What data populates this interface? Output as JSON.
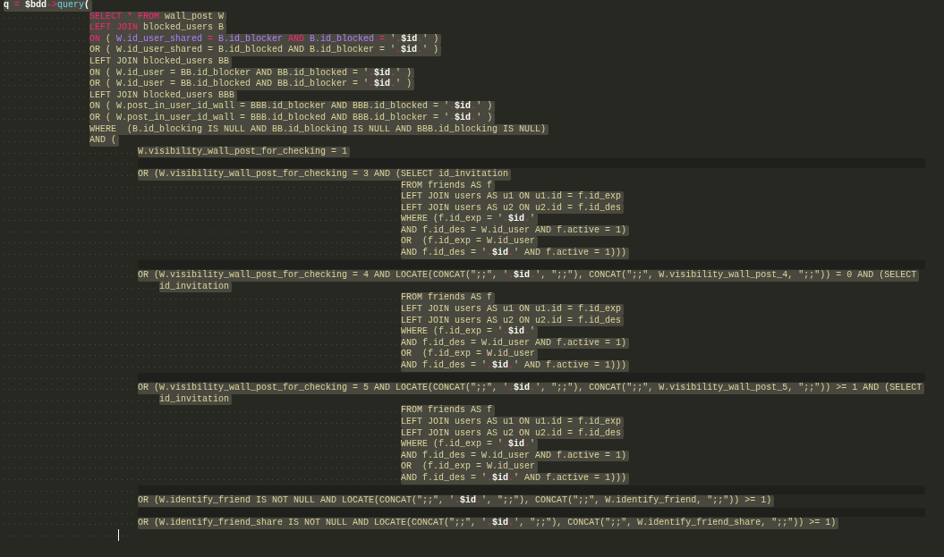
{
  "editor": {
    "lines": [
      {
        "kind": "code",
        "segments": [
          {
            "text": "q ",
            "kind": "variable"
          },
          {
            "text": "=",
            "kind": "operator"
          },
          {
            "text": " $bdd",
            "kind": "variable"
          },
          {
            "text": "->",
            "kind": "operator"
          },
          {
            "text": "query",
            "kind": "function"
          },
          {
            "text": "(",
            "kind": "variable"
          }
        ],
        "children": [
          {
            "kind": "code",
            "segments": [
              {
                "text": "SELECT * FROM",
                "kind": "operator"
              },
              {
                "text": " wall_post W",
                "kind": "plain"
              }
            ]
          },
          {
            "kind": "code",
            "segments": [
              {
                "text": "LEFT JOIN",
                "kind": "operator"
              },
              {
                "text": " blocked_users B",
                "kind": "plain"
              }
            ]
          },
          {
            "kind": "code",
            "segments": [
              {
                "text": "ON",
                "kind": "operator"
              },
              {
                "text": " ( ",
                "kind": "plain"
              },
              {
                "text": "W.id_user_shared",
                "kind": "column"
              },
              {
                "text": " = ",
                "kind": "operator"
              },
              {
                "text": "B.id_blocker",
                "kind": "column"
              },
              {
                "text": " AND ",
                "kind": "operator"
              },
              {
                "text": "B.id_blocked",
                "kind": "column"
              },
              {
                "text": " = ",
                "kind": "operator"
              },
              {
                "text": "'",
                "kind": "plain"
              },
              {
                "text": ".",
                "kind": "operator"
              },
              {
                "text": "$id",
                "kind": "variable"
              },
              {
                "text": ".",
                "kind": "operator"
              },
              {
                "text": "' )",
                "kind": "plain"
              }
            ]
          },
          {
            "kind": "code",
            "segments": [
              {
                "text": "OR ( W.id_user_shared = B.id_blocked AND B.id_blocker = '",
                "kind": "plain"
              },
              {
                "text": ".",
                "kind": "operator"
              },
              {
                "text": "$id",
                "kind": "variable"
              },
              {
                "text": ".",
                "kind": "operator"
              },
              {
                "text": "' )",
                "kind": "plain"
              }
            ]
          },
          {
            "kind": "code",
            "segments": [
              {
                "text": "LEFT JOIN blocked_users BB",
                "kind": "plain"
              }
            ]
          },
          {
            "kind": "code",
            "segments": [
              {
                "text": "ON ( W.id_user = BB.id_blocker AND BB.id_blocked = '",
                "kind": "plain"
              },
              {
                "text": ".",
                "kind": "operator"
              },
              {
                "text": "$id",
                "kind": "variable"
              },
              {
                "text": ".",
                "kind": "operator"
              },
              {
                "text": "' )",
                "kind": "plain"
              }
            ]
          },
          {
            "kind": "code",
            "segments": [
              {
                "text": "OR ( W.id_user = BB.id_blocked AND BB.id_blocker = '",
                "kind": "plain"
              },
              {
                "text": ".",
                "kind": "operator"
              },
              {
                "text": "$id",
                "kind": "variable"
              },
              {
                "text": ".",
                "kind": "operator"
              },
              {
                "text": "' )",
                "kind": "plain"
              }
            ]
          },
          {
            "kind": "code",
            "segments": [
              {
                "text": "LEFT JOIN blocked_users BBB",
                "kind": "plain"
              }
            ]
          },
          {
            "kind": "code",
            "segments": [
              {
                "text": "ON ( W.post_in_user_id_wall = BBB.id_blocker AND BBB.id_blocked = '",
                "kind": "plain"
              },
              {
                "text": ".",
                "kind": "operator"
              },
              {
                "text": "$id",
                "kind": "variable"
              },
              {
                "text": ".",
                "kind": "operator"
              },
              {
                "text": "' )",
                "kind": "plain"
              }
            ]
          },
          {
            "kind": "code",
            "segments": [
              {
                "text": "OR ( W.post_in_user_id_wall = BBB.id_blocked AND BBB.id_blocker = '",
                "kind": "plain"
              },
              {
                "text": ".",
                "kind": "operator"
              },
              {
                "text": "$id",
                "kind": "variable"
              },
              {
                "text": ".",
                "kind": "operator"
              },
              {
                "text": "' )",
                "kind": "plain"
              }
            ]
          },
          {
            "kind": "code",
            "segments": [
              {
                "text": "WHERE  (B.id_blocking IS NULL AND BB.id_blocking IS NULL AND BBB.id_blocking IS NULL)",
                "kind": "plain"
              }
            ]
          },
          {
            "kind": "code",
            "segments": [
              {
                "text": "AND (",
                "kind": "plain"
              }
            ],
            "children": [
              {
                "kind": "code",
                "segments": [
                  {
                    "text": "W.visibility_wall_post_for_checking = 1",
                    "kind": "plain"
                  }
                ]
              },
              {
                "kind": "blank"
              },
              {
                "kind": "code",
                "segments": [
                  {
                    "text": "OR (W.visibility_wall_post_for_checking = 3 AND (SELECT id_invitation",
                    "kind": "plain"
                  }
                ],
                "children": [
                  {
                    "kind": "code",
                    "segments": [
                      {
                        "text": "FROM friends AS f",
                        "kind": "plain"
                      }
                    ]
                  },
                  {
                    "kind": "code",
                    "segments": [
                      {
                        "text": "LEFT JOIN users AS u1 ON u1.id = f.id_exp",
                        "kind": "plain"
                      }
                    ]
                  },
                  {
                    "kind": "code",
                    "segments": [
                      {
                        "text": "LEFT JOIN users AS u2 ON u2.id = f.id_des",
                        "kind": "plain"
                      }
                    ]
                  },
                  {
                    "kind": "code",
                    "segments": [
                      {
                        "text": "WHERE (f.id_exp = '",
                        "kind": "plain"
                      },
                      {
                        "text": ".",
                        "kind": "operator"
                      },
                      {
                        "text": "$id",
                        "kind": "variable"
                      },
                      {
                        "text": ".",
                        "kind": "operator"
                      },
                      {
                        "text": "'",
                        "kind": "plain"
                      }
                    ]
                  },
                  {
                    "kind": "code",
                    "segments": [
                      {
                        "text": "AND f.id_des = W.id_user AND f.active = 1)",
                        "kind": "plain"
                      }
                    ]
                  },
                  {
                    "kind": "code",
                    "segments": [
                      {
                        "text": "OR  (f.id_exp = W.id_user",
                        "kind": "plain"
                      }
                    ]
                  },
                  {
                    "kind": "code",
                    "segments": [
                      {
                        "text": "AND f.id_des = '",
                        "kind": "plain"
                      },
                      {
                        "text": ".",
                        "kind": "operator"
                      },
                      {
                        "text": "$id",
                        "kind": "variable"
                      },
                      {
                        "text": ".",
                        "kind": "operator"
                      },
                      {
                        "text": "' AND f.active = 1)))",
                        "kind": "plain"
                      }
                    ]
                  }
                ]
              },
              {
                "kind": "blank"
              },
              {
                "kind": "code",
                "segments": [
                  {
                    "text": "OR (W.visibility_wall_post_for_checking = 4 AND LOCATE(CONCAT(\";;\", '",
                    "kind": "plain"
                  },
                  {
                    "text": ".",
                    "kind": "operator"
                  },
                  {
                    "text": "$id",
                    "kind": "variable"
                  },
                  {
                    "text": ".",
                    "kind": "operator"
                  },
                  {
                    "text": "', \";;\"), CONCAT(\";;\", W.visibility_wall_post_4, \";;\")) = 0 AND (SELECT",
                    "kind": "plain"
                  }
                ],
                "continuation": "id_invitation",
                "children": [
                  {
                    "kind": "code",
                    "segments": [
                      {
                        "text": "FROM friends AS f",
                        "kind": "plain"
                      }
                    ]
                  },
                  {
                    "kind": "code",
                    "segments": [
                      {
                        "text": "LEFT JOIN users AS u1 ON u1.id = f.id_exp",
                        "kind": "plain"
                      }
                    ]
                  },
                  {
                    "kind": "code",
                    "segments": [
                      {
                        "text": "LEFT JOIN users AS u2 ON u2.id = f.id_des",
                        "kind": "plain"
                      }
                    ]
                  },
                  {
                    "kind": "code",
                    "segments": [
                      {
                        "text": "WHERE (f.id_exp = '",
                        "kind": "plain"
                      },
                      {
                        "text": ".",
                        "kind": "operator"
                      },
                      {
                        "text": "$id",
                        "kind": "variable"
                      },
                      {
                        "text": ".",
                        "kind": "operator"
                      },
                      {
                        "text": "'",
                        "kind": "plain"
                      }
                    ]
                  },
                  {
                    "kind": "code",
                    "segments": [
                      {
                        "text": "AND f.id_des = W.id_user AND f.active = 1)",
                        "kind": "plain"
                      }
                    ]
                  },
                  {
                    "kind": "code",
                    "segments": [
                      {
                        "text": "OR  (f.id_exp = W.id_user",
                        "kind": "plain"
                      }
                    ]
                  },
                  {
                    "kind": "code",
                    "segments": [
                      {
                        "text": "AND f.id_des = '",
                        "kind": "plain"
                      },
                      {
                        "text": ".",
                        "kind": "operator"
                      },
                      {
                        "text": "$id",
                        "kind": "variable"
                      },
                      {
                        "text": ".",
                        "kind": "operator"
                      },
                      {
                        "text": "' AND f.active = 1)))",
                        "kind": "plain"
                      }
                    ]
                  }
                ]
              },
              {
                "kind": "blank"
              },
              {
                "kind": "code",
                "segments": [
                  {
                    "text": "OR (W.visibility_wall_post_for_checking = 5 AND LOCATE(CONCAT(\";;\", '",
                    "kind": "plain"
                  },
                  {
                    "text": ".",
                    "kind": "operator"
                  },
                  {
                    "text": "$id",
                    "kind": "variable"
                  },
                  {
                    "text": ".",
                    "kind": "operator"
                  },
                  {
                    "text": "', \";;\"), CONCAT(\";;\", W.visibility_wall_post_5, \";;\")) >= 1 AND (SELECT",
                    "kind": "plain"
                  }
                ],
                "continuation": "id_invitation",
                "children": [
                  {
                    "kind": "code",
                    "segments": [
                      {
                        "text": "FROM friends AS f",
                        "kind": "plain"
                      }
                    ]
                  },
                  {
                    "kind": "code",
                    "segments": [
                      {
                        "text": "LEFT JOIN users AS u1 ON u1.id = f.id_exp",
                        "kind": "plain"
                      }
                    ]
                  },
                  {
                    "kind": "code",
                    "segments": [
                      {
                        "text": "LEFT JOIN users AS u2 ON u2.id = f.id_des",
                        "kind": "plain"
                      }
                    ]
                  },
                  {
                    "kind": "code",
                    "segments": [
                      {
                        "text": "WHERE (f.id_exp = '",
                        "kind": "plain"
                      },
                      {
                        "text": ".",
                        "kind": "operator"
                      },
                      {
                        "text": "$id",
                        "kind": "variable"
                      },
                      {
                        "text": ".",
                        "kind": "operator"
                      },
                      {
                        "text": "'",
                        "kind": "plain"
                      }
                    ]
                  },
                  {
                    "kind": "code",
                    "segments": [
                      {
                        "text": "AND f.id_des = W.id_user AND f.active = 1)",
                        "kind": "plain"
                      }
                    ]
                  },
                  {
                    "kind": "code",
                    "segments": [
                      {
                        "text": "OR  (f.id_exp = W.id_user",
                        "kind": "plain"
                      }
                    ]
                  },
                  {
                    "kind": "code",
                    "segments": [
                      {
                        "text": "AND f.id_des = '",
                        "kind": "plain"
                      },
                      {
                        "text": ".",
                        "kind": "operator"
                      },
                      {
                        "text": "$id",
                        "kind": "variable"
                      },
                      {
                        "text": ".",
                        "kind": "operator"
                      },
                      {
                        "text": "' AND f.active = 1)))",
                        "kind": "plain"
                      }
                    ]
                  }
                ]
              },
              {
                "kind": "blank"
              },
              {
                "kind": "code",
                "segments": [
                  {
                    "text": "OR (W.identify_friend IS NOT NULL AND LOCATE(CONCAT(\";;\", '",
                    "kind": "plain"
                  },
                  {
                    "text": ".",
                    "kind": "operator"
                  },
                  {
                    "text": "$id",
                    "kind": "variable"
                  },
                  {
                    "text": ".",
                    "kind": "operator"
                  },
                  {
                    "text": "', \";;\"), CONCAT(\";;\", W.identify_friend, \";;\")) >= 1)",
                    "kind": "plain"
                  }
                ]
              },
              {
                "kind": "blank"
              },
              {
                "kind": "code",
                "segments": [
                  {
                    "text": "OR (W.identify_friend_share IS NOT NULL AND LOCATE(CONCAT(\";;\", '",
                    "kind": "plain"
                  },
                  {
                    "text": ".",
                    "kind": "operator"
                  },
                  {
                    "text": "$id",
                    "kind": "variable"
                  },
                  {
                    "text": ".",
                    "kind": "operator"
                  },
                  {
                    "text": "', \";;\"), CONCAT(\";;\", W.identify_friend_share, \";;\")) >= 1)",
                    "kind": "plain"
                  }
                ]
              },
              {
                "kind": "caret"
              }
            ]
          }
        ]
      }
    ]
  }
}
